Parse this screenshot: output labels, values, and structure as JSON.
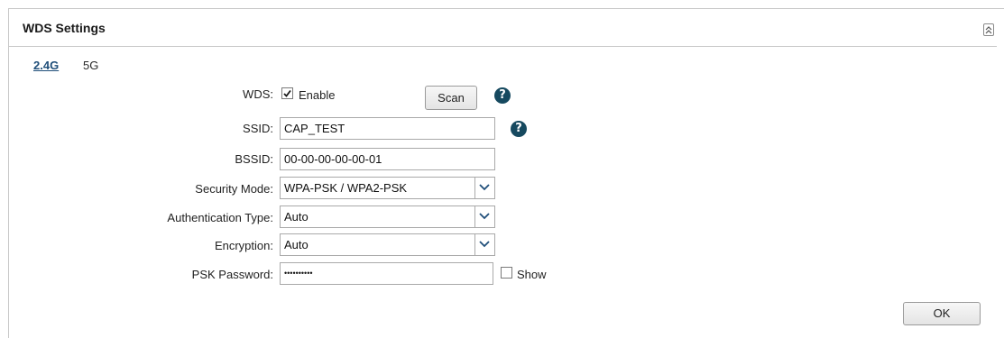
{
  "panel": {
    "title": "WDS Settings",
    "collapse_icon": "double-chevron-up-icon"
  },
  "tabs": [
    {
      "label": "2.4G",
      "active": true
    },
    {
      "label": "5G",
      "active": false
    }
  ],
  "form": {
    "wds": {
      "label": "WDS:",
      "checkbox_label": "Enable",
      "checked": true
    },
    "scan_button": "Scan",
    "ssid": {
      "label": "SSID:",
      "value": "CAP_TEST"
    },
    "bssid": {
      "label": "BSSID:",
      "value": "00-00-00-00-00-01"
    },
    "security_mode": {
      "label": "Security Mode:",
      "selected": "WPA-PSK / WPA2-PSK"
    },
    "auth_type": {
      "label": "Authentication Type:",
      "selected": "Auto"
    },
    "encryption": {
      "label": "Encryption:",
      "selected": "Auto"
    },
    "psk_password": {
      "label": "PSK Password:",
      "value": "••••••••••"
    },
    "show_password": {
      "label": "Show",
      "checked": false
    },
    "help_icon_glyph": "?"
  },
  "ok_button": "OK",
  "colors": {
    "accent": "#1f4e79",
    "help_icon": "#16495f"
  }
}
